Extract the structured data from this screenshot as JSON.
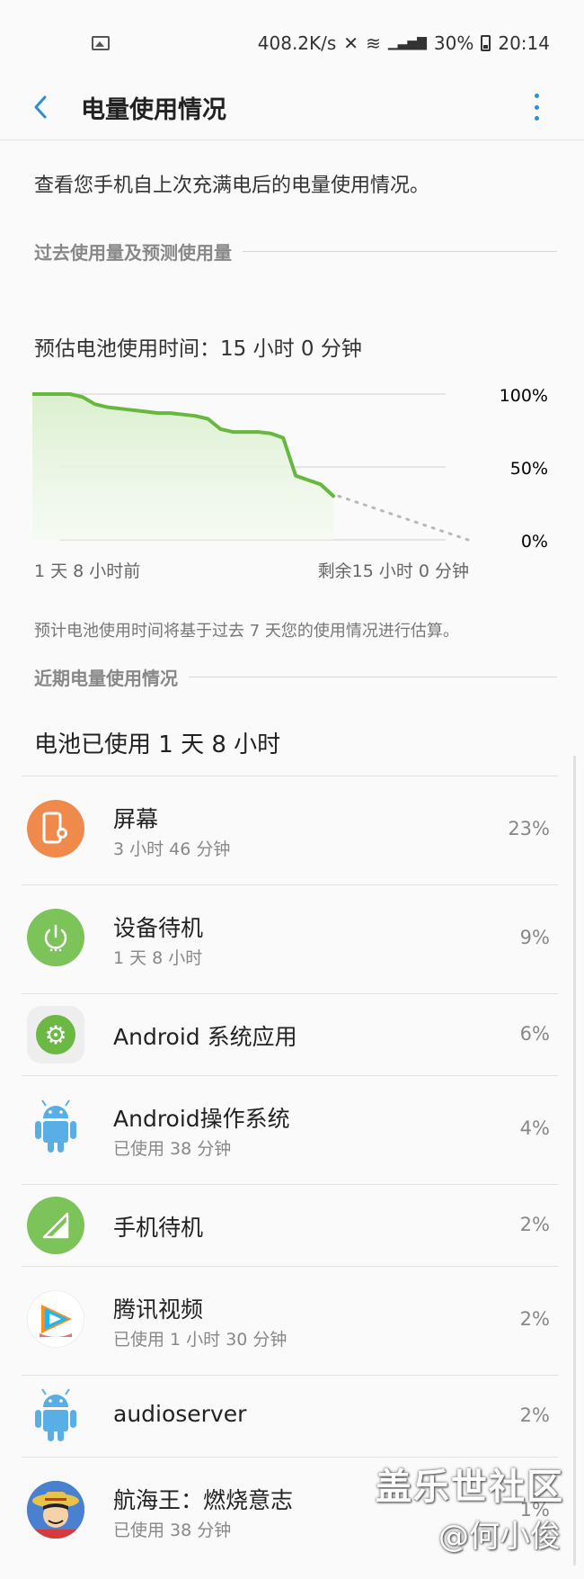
{
  "status_bar": {
    "speed": "408.2K/s",
    "battery": "30%",
    "time": "20:14"
  },
  "app_bar": {
    "title": "电量使用情况"
  },
  "intro": "查看您手机自上次充满电后的电量使用情况。",
  "past_section": {
    "title": "过去使用量及预测使用量"
  },
  "estimate": "预估电池使用时间：15 小时 0 分钟",
  "chart_data": {
    "type": "line",
    "yticks": [
      "100%",
      "50%",
      "0%"
    ],
    "ylim": [
      0,
      100
    ],
    "x_start_label": "1 天 8 小时前",
    "x_end_label": "剩余15 小时 0 分钟",
    "series": [
      {
        "values": [
          100,
          100,
          100,
          100,
          98,
          93,
          91,
          90,
          89,
          88,
          87,
          87,
          86,
          85,
          83,
          76,
          74,
          74,
          74,
          73,
          70,
          44,
          41,
          38,
          30
        ]
      },
      {
        "values": [
          30,
          0
        ]
      }
    ],
    "colors": {
      "line": "#66b83e",
      "fill": "#e6f4dc",
      "forecast": "#b8b8b8"
    }
  },
  "note": "预计电池使用时间将基于过去 7 天您的使用情况进行估算。",
  "recent_section": {
    "title": "近期电量使用情况"
  },
  "battery_used": "电池已使用 1 天 8 小时",
  "items": [
    {
      "name": "屏幕",
      "sub": "3 小时 46 分钟",
      "pct": "23%",
      "icon": "phone-brightness-icon"
    },
    {
      "name": "设备待机",
      "sub": "1 天 8 小时",
      "pct": "9%",
      "icon": "power-icon"
    },
    {
      "name": "Android 系统应用",
      "sub": "",
      "pct": "6%",
      "icon": "settings-gear-icon"
    },
    {
      "name": "Android操作系统",
      "sub": "已使用 38 分钟",
      "pct": "4%",
      "icon": "android-icon"
    },
    {
      "name": "手机待机",
      "sub": "",
      "pct": "2%",
      "icon": "signal-icon"
    },
    {
      "name": "腾讯视频",
      "sub": "已使用 1 小时 30 分钟",
      "pct": "2%",
      "icon": "tencent-video-icon"
    },
    {
      "name": "audioserver",
      "sub": "",
      "pct": "2%",
      "icon": "android-icon"
    },
    {
      "name": "航海王：燃烧意志",
      "sub": "已使用 38 分钟",
      "pct": "1%",
      "icon": "one-piece-game-icon"
    }
  ],
  "watermark": {
    "line1": "盖乐世社区",
    "line2": "@何小俊"
  }
}
